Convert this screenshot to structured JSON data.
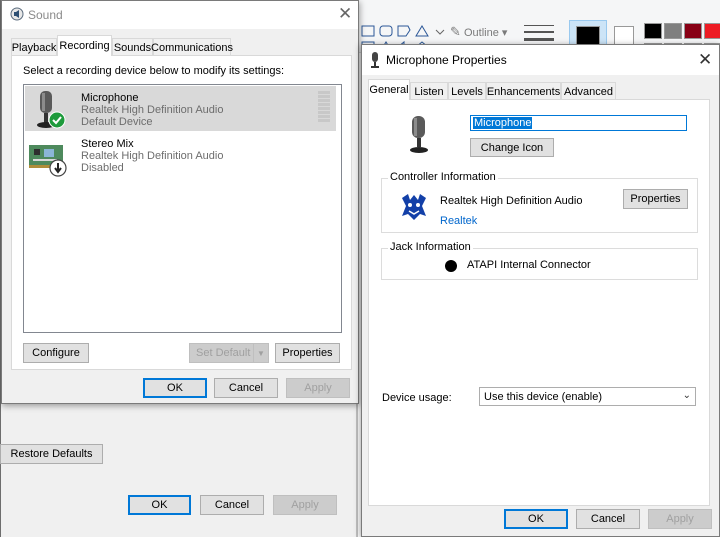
{
  "background_window": {
    "restore_defaults": "Restore Defaults",
    "ok": "OK",
    "cancel": "Cancel",
    "apply": "Apply"
  },
  "paint_ribbon": {
    "outline_label": "Outline",
    "colors": [
      "#000000",
      "#7f7f7f",
      "#880015",
      "#ed1c24",
      "#ffffff",
      "#c3c3c3",
      "#b97a57",
      "#ffaec9"
    ]
  },
  "sound_dialog": {
    "title": "Sound",
    "tabs": [
      "Playback",
      "Recording",
      "Sounds",
      "Communications"
    ],
    "active_tab": "Recording",
    "instruction": "Select a recording device below to modify its settings:",
    "devices": [
      {
        "name": "Microphone",
        "driver": "Realtek High Definition Audio",
        "status": "Default Device"
      },
      {
        "name": "Stereo Mix",
        "driver": "Realtek High Definition Audio",
        "status": "Disabled"
      }
    ],
    "configure": "Configure",
    "set_default": "Set Default",
    "properties": "Properties",
    "ok": "OK",
    "cancel": "Cancel",
    "apply": "Apply"
  },
  "mic_properties": {
    "title": "Microphone Properties",
    "tabs": [
      "General",
      "Listen",
      "Levels",
      "Enhancements",
      "Advanced"
    ],
    "active_tab": "General",
    "device_name_value": "Microphone",
    "change_icon": "Change Icon",
    "controller_group": "Controller Information",
    "controller_name": "Realtek High Definition Audio",
    "controller_vendor": "Realtek",
    "controller_properties": "Properties",
    "jack_group": "Jack Information",
    "jack_connector": "ATAPI Internal Connector",
    "device_usage_label": "Device usage:",
    "device_usage_value": "Use this device (enable)",
    "ok": "OK",
    "cancel": "Cancel",
    "apply": "Apply"
  }
}
